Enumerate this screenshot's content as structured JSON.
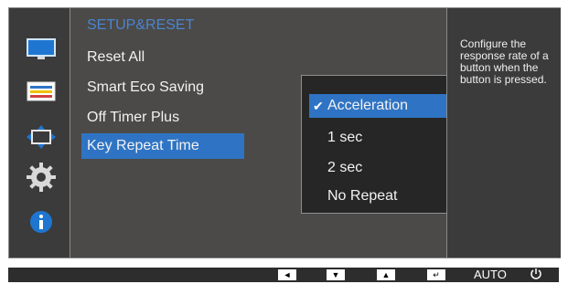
{
  "sidebar": {
    "items": [
      {
        "icon": "monitor-icon"
      },
      {
        "icon": "picture-layout-icon"
      },
      {
        "icon": "position-arrows-icon"
      },
      {
        "icon": "gear-icon"
      },
      {
        "icon": "info-icon"
      }
    ]
  },
  "main": {
    "title": "SETUP&RESET",
    "menu": [
      {
        "label": "Reset All"
      },
      {
        "label": "Smart Eco Saving"
      },
      {
        "label": "Off Timer Plus"
      },
      {
        "label": "Key Repeat Time",
        "selected": true
      }
    ]
  },
  "submenu": {
    "options": [
      {
        "label": "Acceleration",
        "selected": true
      },
      {
        "label": "1 sec"
      },
      {
        "label": "2 sec"
      },
      {
        "label": "No Repeat"
      }
    ]
  },
  "help": {
    "text": "Configure the response rate of a button when the button is pressed."
  },
  "bottom_bar": {
    "left_label": "◄",
    "down_label": "▼",
    "up_label": "▲",
    "enter_label": "↵",
    "auto_label": "AUTO",
    "power_icon": "power-icon"
  },
  "colors": {
    "accent": "#2f74c4",
    "title": "#4b84d0"
  }
}
